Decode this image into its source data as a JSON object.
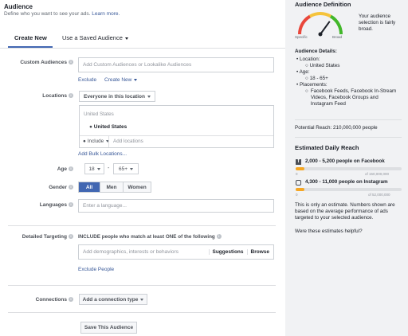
{
  "header": {
    "title": "Audience",
    "subtitle": "Define who you want to see your ads.",
    "learn_more": "Learn more."
  },
  "tabs": [
    {
      "label": "Create New"
    },
    {
      "label": "Use a Saved Audience"
    }
  ],
  "custom_audiences": {
    "label": "Custom Audiences",
    "placeholder": "Add Custom Audiences or Lookalike Audiences",
    "exclude": "Exclude",
    "create_new": "Create New"
  },
  "locations": {
    "label": "Locations",
    "scope": "Everyone in this location",
    "country_group": "United States",
    "selected": "United States",
    "include": "Include",
    "placeholder": "Add locations",
    "bulk": "Add Bulk Locations..."
  },
  "age": {
    "label": "Age",
    "min": "18",
    "dash": "-",
    "max": "65+"
  },
  "gender": {
    "label": "Gender",
    "options": [
      "All",
      "Men",
      "Women"
    ],
    "selected": "All"
  },
  "languages": {
    "label": "Languages",
    "placeholder": "Enter a language..."
  },
  "detailed_targeting": {
    "label": "Detailed Targeting",
    "instruction": "INCLUDE people who match at least ONE of the following",
    "placeholder": "Add demographics, interests or behaviors",
    "suggestions": "Suggestions",
    "browse": "Browse",
    "exclude_people": "Exclude People"
  },
  "connections": {
    "label": "Connections",
    "button": "Add a connection type"
  },
  "save_button": "Save This Audience",
  "sidebar": {
    "definition_title": "Audience Definition",
    "gauge_specific": "Specific",
    "gauge_broad": "Broad",
    "gauge_level": 0.7,
    "definition_text": "Your audience selection is fairly broad.",
    "details_title": "Audience Details:",
    "details": {
      "location_label": "Location:",
      "location_value": "United States",
      "age_label": "Age:",
      "age_value": "18 - 65+",
      "placements_label": "Placements:",
      "placements_value": "Facebook Feeds, Facebook In-Stream Videos, Facebook Groups and Instagram Feed"
    },
    "potential_reach": "Potential Reach: 210,000,000 people",
    "daily_reach_title": "Estimated Daily Reach",
    "facebook": {
      "text": "2,000 - 5,200 people on Facebook",
      "min": "0",
      "max": "of 150,000,000",
      "fill_fraction": 0.08
    },
    "instagram": {
      "text": "4,300 - 11,000 people on Instagram",
      "min": "0",
      "max": "of 52,000,000",
      "fill_fraction": 0.08
    },
    "estimate_note": "This is only an estimate. Numbers shown are based on the average performance of ads targeted to your selected audience.",
    "estimate_link": "Were these estimates helpful?"
  },
  "colors": {
    "accent": "#4267b2",
    "link": "#385898",
    "gauge_needle": "#1d2129",
    "reach_fill": "#f5a623"
  }
}
